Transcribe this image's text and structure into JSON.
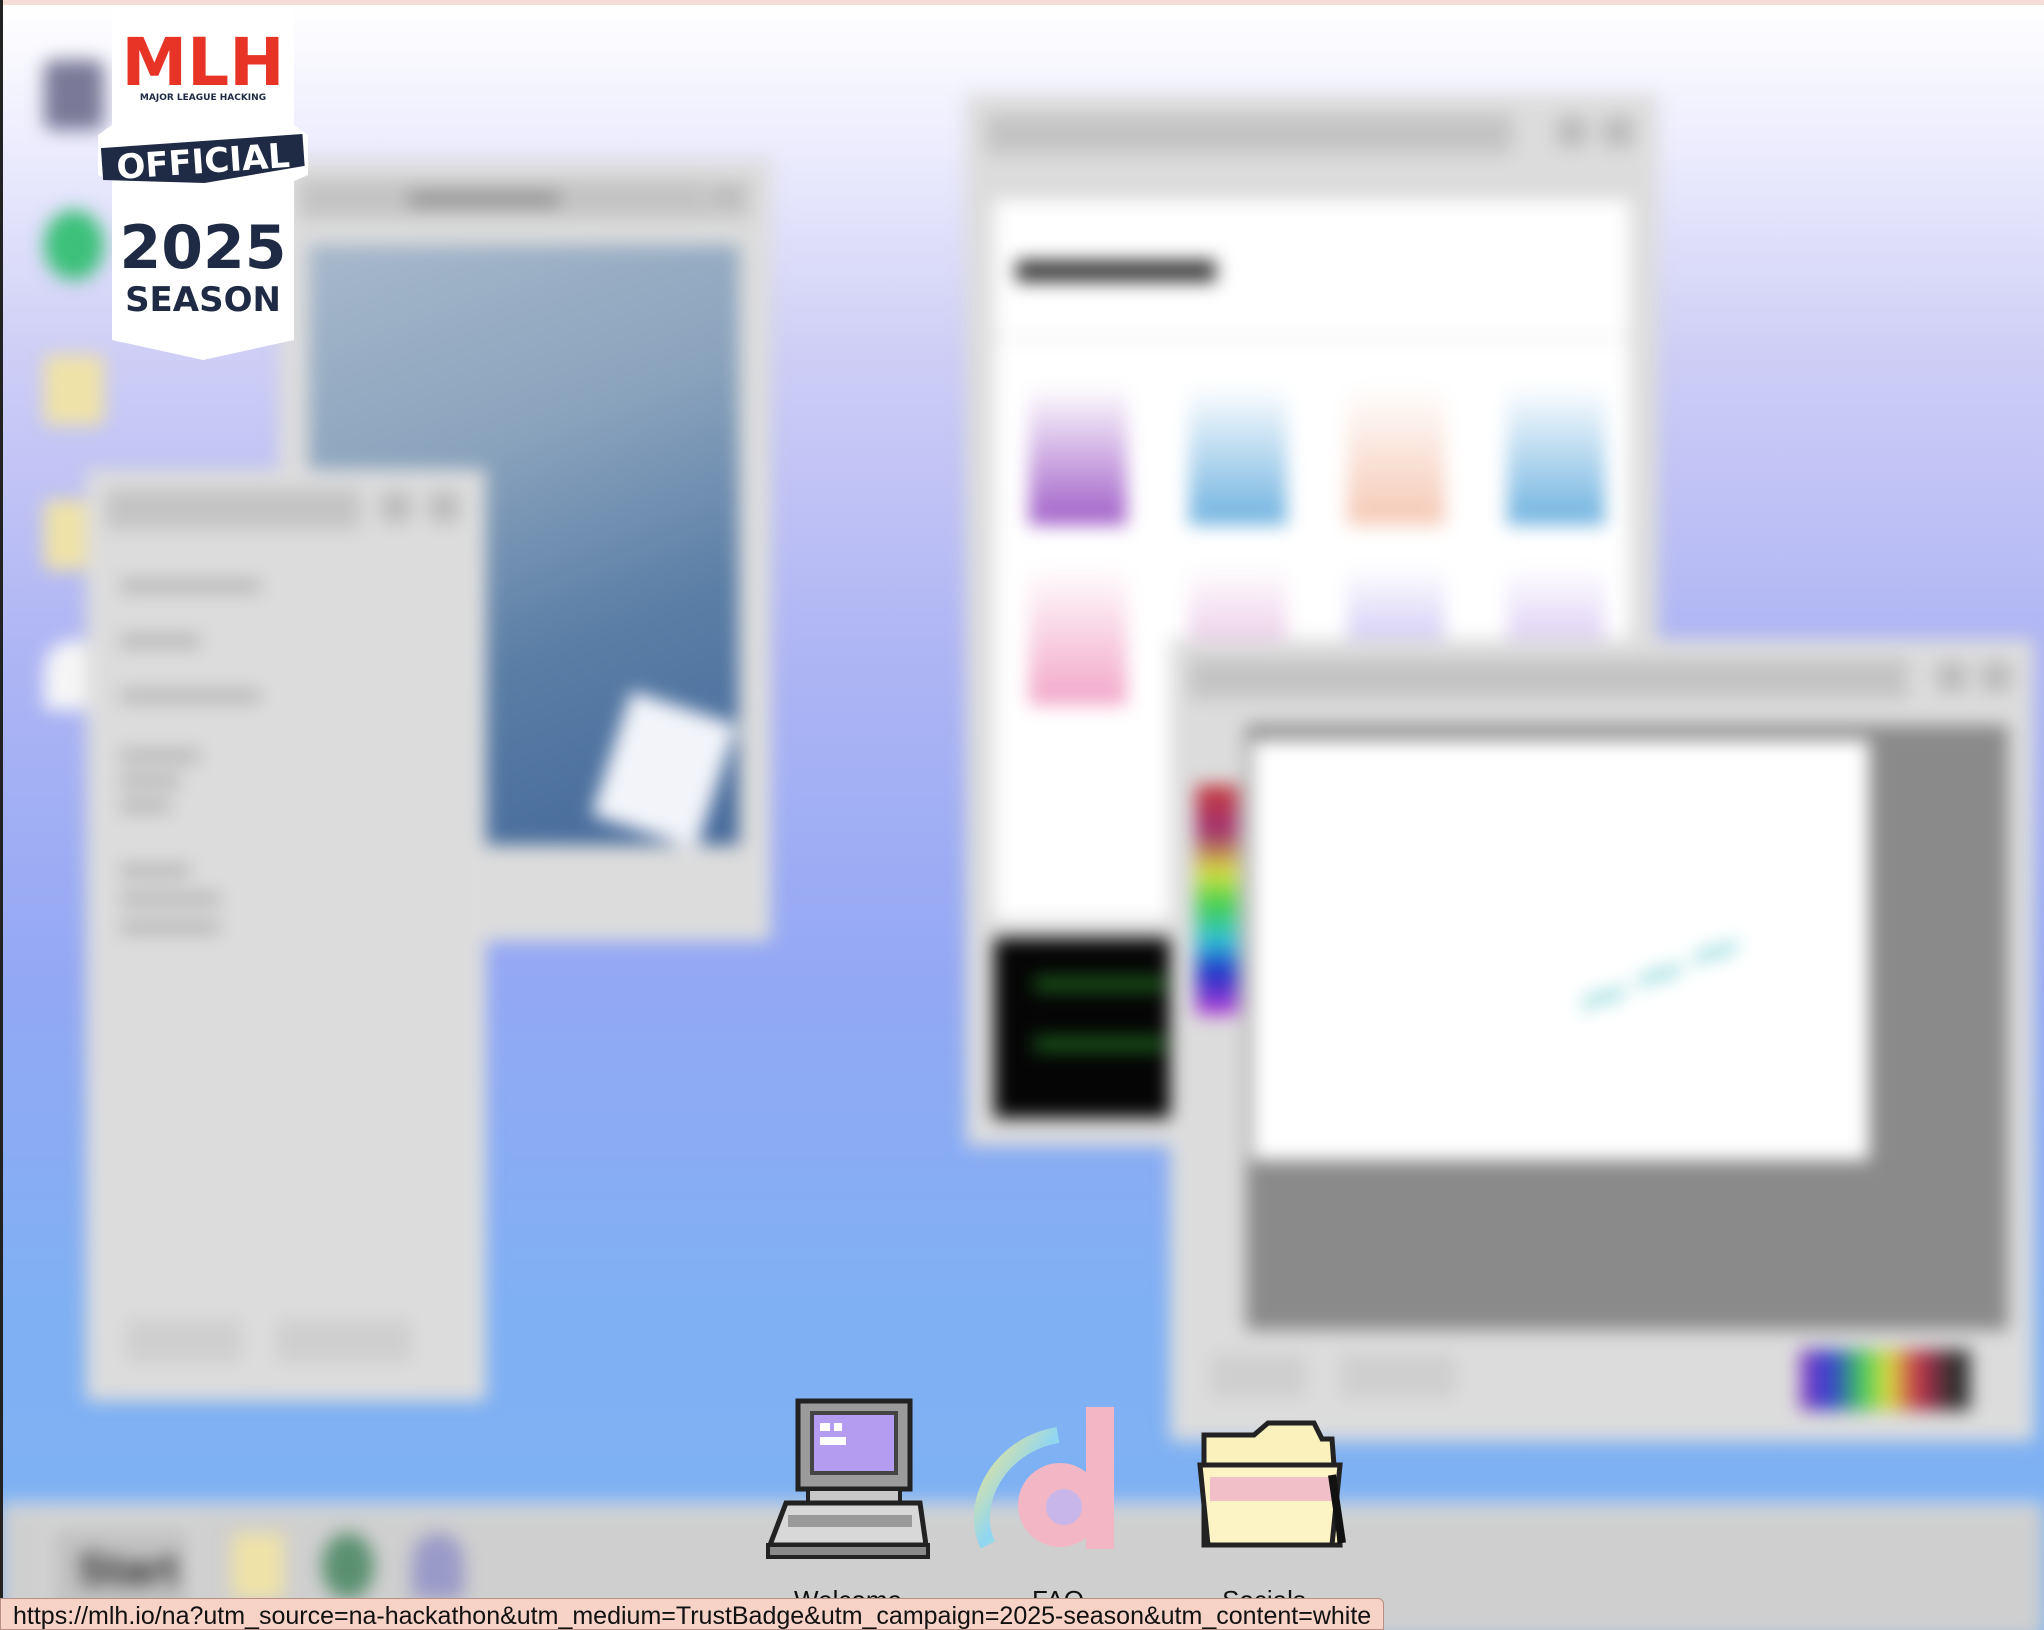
{
  "browser": {
    "status_url": "https://mlh.io/na?utm_source=na-hackathon&utm_medium=TrustBadge&utm_campaign=2025-season&utm_content=white"
  },
  "mlh_badge": {
    "logo_text": "MLH",
    "logo_subtitle": "MAJOR LEAGUE HACKING",
    "banner": "OFFICIAL",
    "year": "2025",
    "season": "SEASON",
    "colors": {
      "navy": "#1f2a44",
      "red": "#e73427",
      "blue": "#1b6eb5",
      "yellow": "#f2b51c"
    }
  },
  "dock": {
    "items": [
      {
        "label": "Welcome",
        "icon": "computer-icon"
      },
      {
        "label": "FAQ",
        "icon": "browser-icon"
      },
      {
        "label": "Socials",
        "icon": "folder-icon"
      }
    ]
  },
  "taskbar": {
    "start_label": "Start"
  },
  "theme": {
    "desktop_top": "#ffffff",
    "desktop_bottom": "#7db2f2",
    "window_gray": "#dcdcdc",
    "status_bar_bg": "#f7d2c6"
  }
}
